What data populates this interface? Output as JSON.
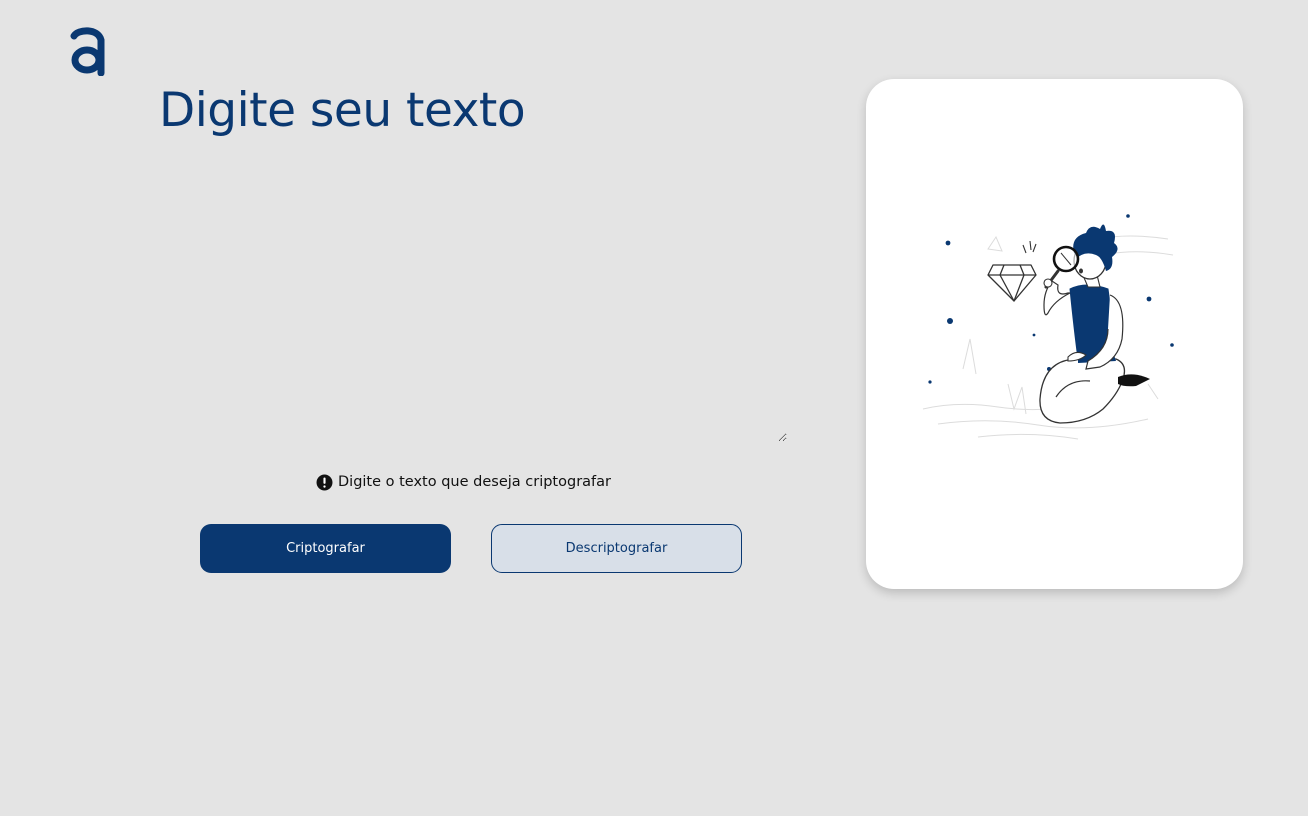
{
  "logo": {
    "icon": "alura-a-logo-icon",
    "color": "#0a3871"
  },
  "input": {
    "placeholder": "Digite seu texto",
    "value": ""
  },
  "info": {
    "icon": "exclamation-circle-icon",
    "text": "Digite o texto que deseja criptografar"
  },
  "buttons": {
    "encrypt_label": "Criptografar",
    "decrypt_label": "Descriptografar"
  },
  "card": {
    "illustration": "boy-with-magnifying-glass-and-diamond-illustration"
  },
  "colors": {
    "accent": "#0a3871",
    "background": "#e4e4e4",
    "secondary_button_bg": "#d8dfe8"
  }
}
